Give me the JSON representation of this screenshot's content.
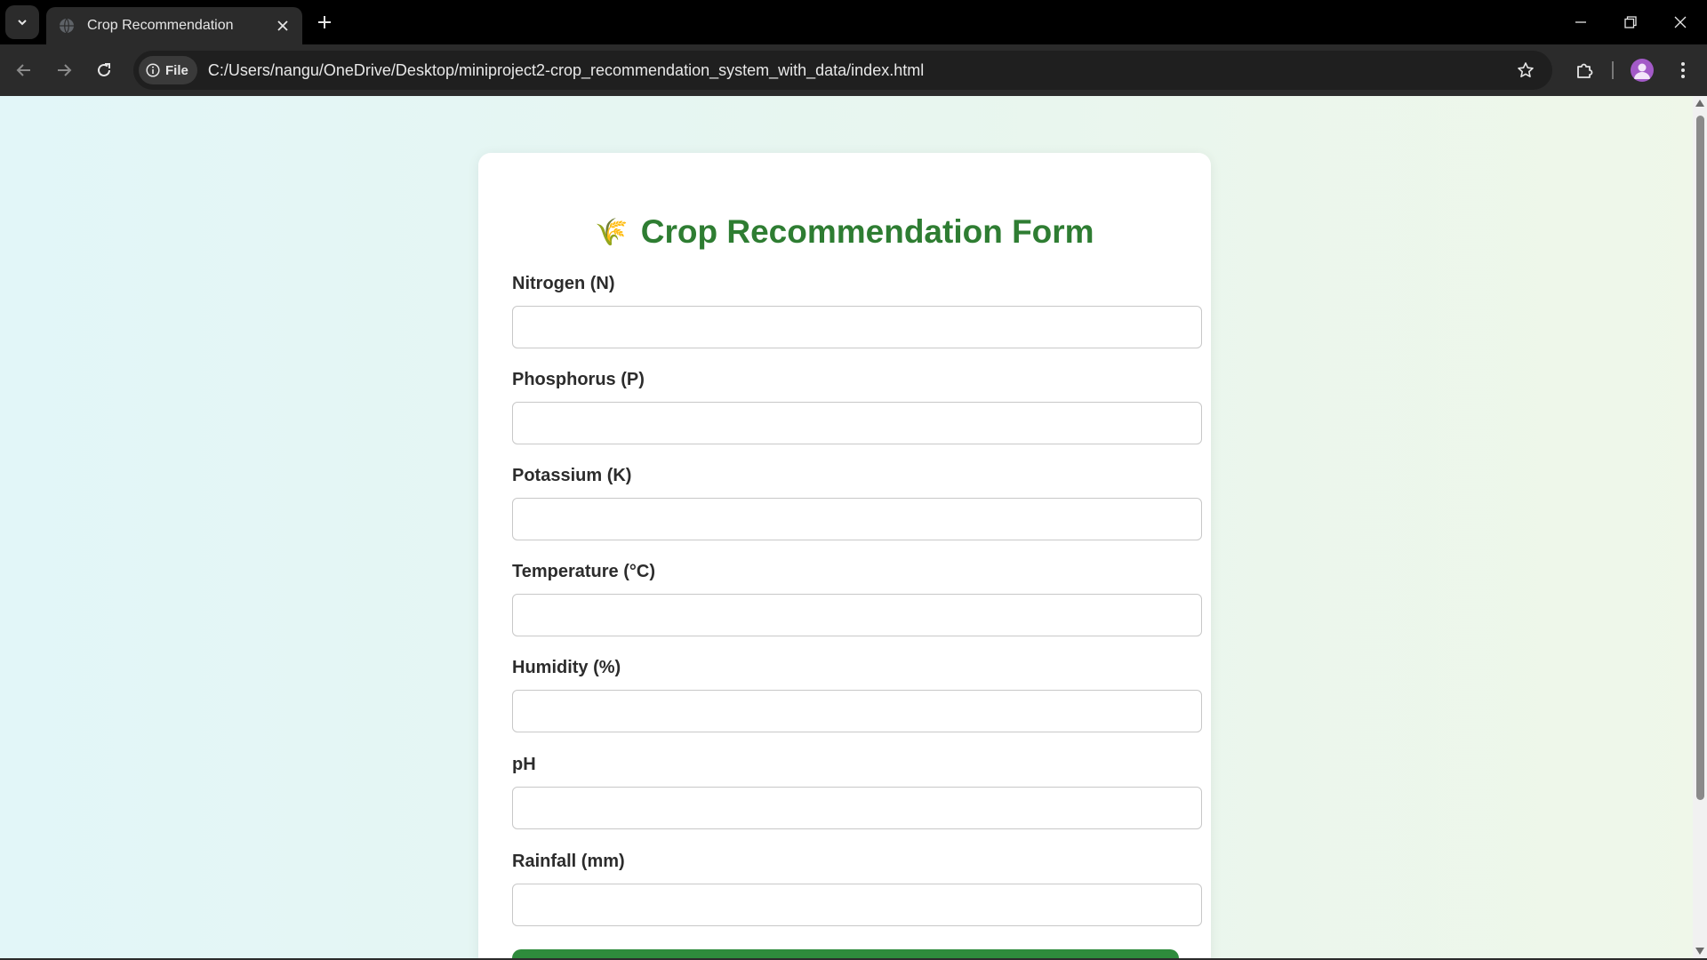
{
  "browser": {
    "tab_title": "Crop Recommendation",
    "site_chip_label": "File",
    "url": "C:/Users/nangu/OneDrive/Desktop/miniproject2-crop_recommendation_system_with_data/index.html"
  },
  "page": {
    "title": "Crop Recommendation Form",
    "title_emoji": "🌾",
    "fields": [
      {
        "label": "Nitrogen (N)",
        "value": ""
      },
      {
        "label": "Phosphorus (P)",
        "value": ""
      },
      {
        "label": "Potassium (K)",
        "value": ""
      },
      {
        "label": "Temperature (°C)",
        "value": ""
      },
      {
        "label": "Humidity (%)",
        "value": ""
      },
      {
        "label": "pH",
        "value": ""
      },
      {
        "label": "Rainfall (mm)",
        "value": ""
      }
    ]
  },
  "colors": {
    "title_green": "#2e7d32",
    "button_green": "#2e8b3c",
    "chrome_dark": "#2b2b2b"
  }
}
